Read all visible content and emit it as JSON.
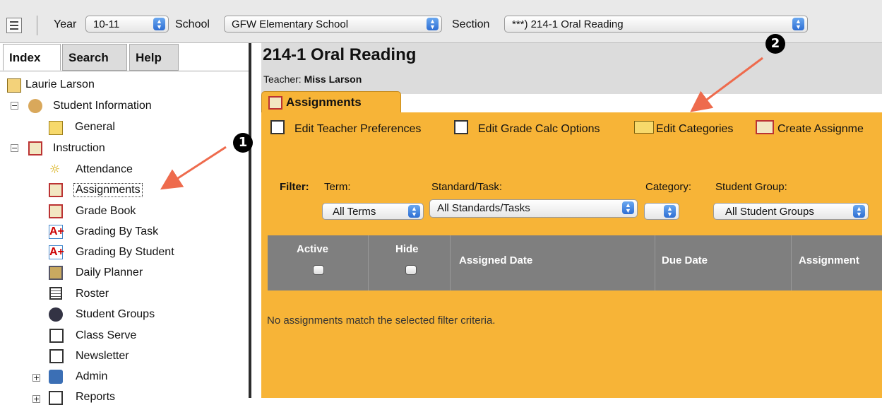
{
  "topbar": {
    "year_label": "Year",
    "year_value": "10-11",
    "school_label": "School",
    "school_value": "GFW Elementary School",
    "section_label": "Section",
    "section_value": "***) 214-1 Oral Reading"
  },
  "tabs": [
    "Index",
    "Search",
    "Help"
  ],
  "tree": {
    "user": "Laurie Larson",
    "student_information": "Student Information",
    "general": "General",
    "instruction": "Instruction",
    "items": [
      "Attendance",
      "Assignments",
      "Grade Book",
      "Grading By Task",
      "Grading By Student",
      "Daily Planner",
      "Roster",
      "Student Groups",
      "Class Serve",
      "Newsletter"
    ],
    "admin": "Admin",
    "reports": "Reports"
  },
  "main": {
    "title": "214-1 Oral Reading",
    "teacher_label": "Teacher:",
    "teacher_name": "Miss Larson",
    "tab": "Assignments",
    "toolbar": {
      "edit_teacher_preferences": "Edit Teacher Preferences",
      "edit_grade_calc_options": "Edit Grade Calc Options",
      "edit_categories": "Edit Categories",
      "create_assignment": "Create Assignme"
    },
    "filter": {
      "label": "Filter:",
      "term_label": "Term:",
      "term_value": "All Terms",
      "standard_label": "Standard/Task:",
      "standard_value": "All Standards/Tasks",
      "category_label": "Category:",
      "category_value": "",
      "group_label": "Student Group:",
      "group_value": "All Student Groups"
    },
    "table_headers": [
      "Active",
      "Hide",
      "Assigned Date",
      "Due Date",
      "Assignment"
    ],
    "empty_message": "No assignments match the selected filter criteria."
  },
  "annotations": {
    "callout_1": "❶",
    "callout_2": "❷",
    "arrow_color": "#ee6b4d"
  }
}
